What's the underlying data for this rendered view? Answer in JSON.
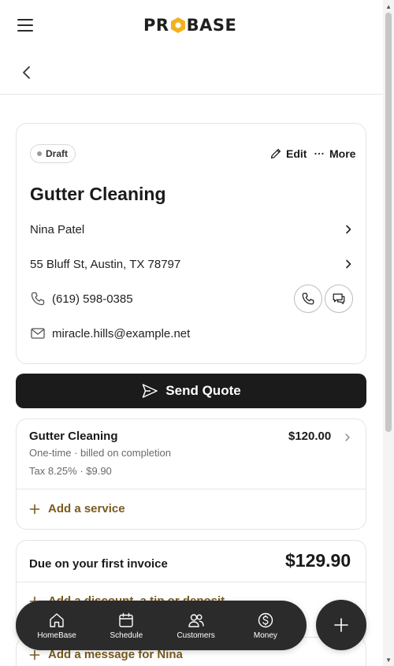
{
  "app": {
    "logo_text_left": "PR",
    "logo_text_right": "BASE"
  },
  "colors": {
    "accent": "#F2B21D",
    "dark": "#1b1b1b",
    "link": "#7a5a1e",
    "border": "#e4e4e4"
  },
  "quote": {
    "status": "Draft",
    "edit_label": "Edit",
    "more_label": "More",
    "title": "Gutter Cleaning",
    "customer_name": "Nina Patel",
    "address": "55 Bluff St, Austin, TX 78797",
    "phone": "(619) 598-0385",
    "email": "miracle.hills@example.net",
    "send_label": "Send Quote"
  },
  "service": {
    "name": "Gutter Cleaning",
    "price": "$120.00",
    "billing": "One-time · billed on completion",
    "tax": "Tax 8.25% · $9.90",
    "add_label": "Add a service"
  },
  "due": {
    "label": "Due on your first invoice",
    "amount": "$129.90",
    "add_label": "Add a discount, a tip or deposit"
  },
  "message": {
    "add_label": "Add a message for Nina"
  },
  "nav": {
    "items": [
      {
        "label": "HomeBase",
        "icon": "home-icon"
      },
      {
        "label": "Schedule",
        "icon": "calendar-icon"
      },
      {
        "label": "Customers",
        "icon": "users-icon"
      },
      {
        "label": "Money",
        "icon": "dollar-icon"
      }
    ]
  }
}
